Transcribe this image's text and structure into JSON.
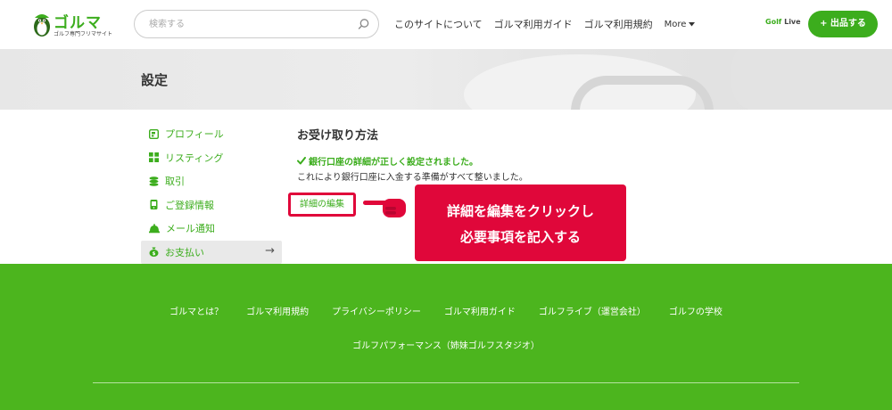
{
  "colors": {
    "brand_green": "#3cad1d",
    "footer_green": "#4cb51e",
    "callout_red": "#e0073a"
  },
  "header": {
    "logo_title": "ゴルマ",
    "logo_sub": "ゴルフ専門フリマサイト",
    "search_placeholder": "検索する",
    "nav": [
      "このサイトについて",
      "ゴルマ利用ガイド",
      "ゴルマ利用規約"
    ],
    "more_label": "More",
    "golflive_a": "Golf",
    "golflive_b": "Live",
    "list_button": "+ 出品する"
  },
  "banner": {
    "title": "設定"
  },
  "sidebar": {
    "items": [
      {
        "label": "プロフィール",
        "icon": "profile-icon"
      },
      {
        "label": "リスティング",
        "icon": "grid-icon"
      },
      {
        "label": "取引",
        "icon": "coins-icon"
      },
      {
        "label": "ご登録情報",
        "icon": "phone-icon"
      },
      {
        "label": "メール通知",
        "icon": "bell-icon"
      },
      {
        "label": "お支払い",
        "icon": "money-bag-icon"
      }
    ],
    "active_arrow": "→"
  },
  "main": {
    "heading": "お受け取り方法",
    "success_message": "銀行口座の詳細が正しく設定されました。",
    "success_sub": "これにより銀行口座に入金する準備がすべて整いました。",
    "edit_link": "詳細の編集",
    "callout_line1": "詳細を編集をクリックし",
    "callout_line2": "必要事項を記入する"
  },
  "footer": {
    "links_row1": [
      "ゴルマとは？",
      "ゴルマ利用規約",
      "プライバシーポリシー",
      "ゴルマ利用ガイド",
      "ゴルフライブ（運営会社）",
      "ゴルフの学校"
    ],
    "links_row2": [
      "ゴルフパフォーマンス（姉妹ゴルフスタジオ）"
    ]
  }
}
